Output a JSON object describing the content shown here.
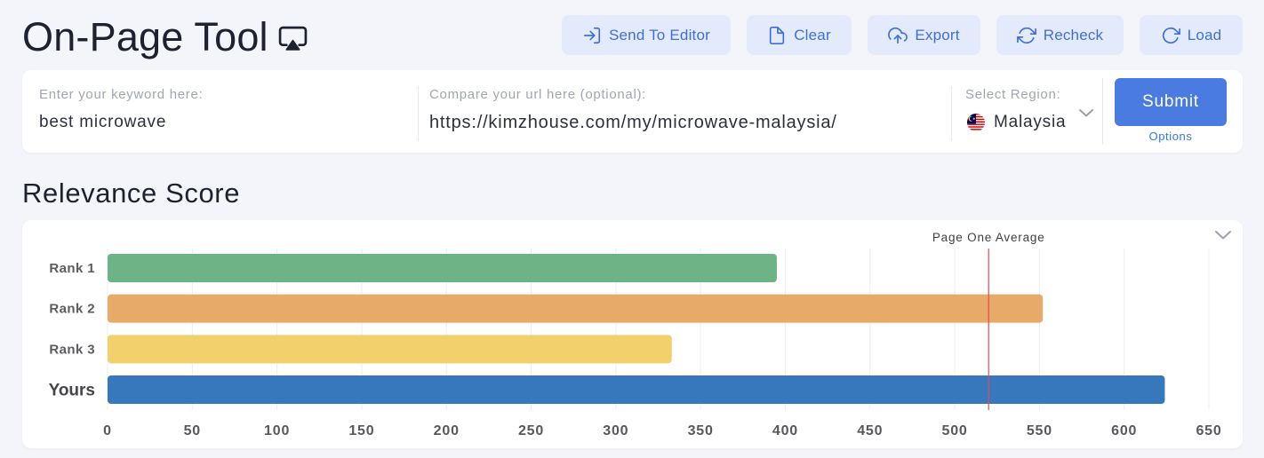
{
  "theme": {
    "accent": "#4a7be1",
    "button_bg": "#e3eafb",
    "button_text": "#3f6fd6",
    "link": "#2f7be0",
    "page_bg": "#f4f5fa"
  },
  "header": {
    "title": "On-Page Tool",
    "title_icon": "cast-icon"
  },
  "toolbar": {
    "buttons": [
      {
        "label": "Send To Editor",
        "icon": "sign-in-icon"
      },
      {
        "label": "Clear",
        "icon": "file-icon"
      },
      {
        "label": "Export",
        "icon": "cloud-upload-icon"
      },
      {
        "label": "Recheck",
        "icon": "refresh-icon"
      },
      {
        "label": "Load",
        "icon": "rotate-cw-icon"
      }
    ]
  },
  "form": {
    "keyword": {
      "label": "Enter your keyword here:",
      "value": "best microwave"
    },
    "compare_url": {
      "label": "Compare your url here (optional):",
      "value": "https://kimzhouse.com/my/microwave-malaysia/"
    },
    "region": {
      "label": "Select Region:",
      "value": "Malaysia",
      "flag_icon": "malaysia-flag-icon",
      "dropdown_icon": "chevron-down-icon"
    },
    "submit": {
      "label": "Submit"
    },
    "options": {
      "label": "Options"
    }
  },
  "relevance_score": {
    "heading": "Relevance Score",
    "collapse_icon": "chevron-down-icon"
  },
  "chart_data": {
    "type": "bar",
    "orientation": "horizontal",
    "categories": [
      "Rank 1",
      "Rank 2",
      "Rank 3",
      "Yours"
    ],
    "values": [
      395,
      552,
      333,
      624
    ],
    "colors": [
      "#6db386",
      "#e8aa69",
      "#f2d06b",
      "#3778bd"
    ],
    "xlim": [
      0,
      650
    ],
    "xticks": [
      0,
      50,
      100,
      150,
      200,
      250,
      300,
      350,
      400,
      450,
      500,
      550,
      600,
      650
    ],
    "grid": true,
    "legend": "none",
    "reference_line": {
      "label": "Page One Average",
      "value": 520,
      "color": "#e84855"
    }
  }
}
